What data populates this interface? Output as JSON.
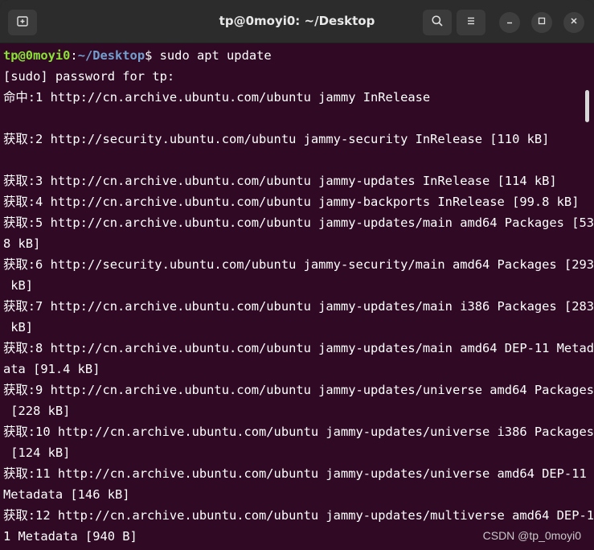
{
  "window": {
    "title": "tp@0moyi0: ~/Desktop"
  },
  "toolbar": {
    "new_tab_icon": "new-tab-icon",
    "search_icon": "search-icon",
    "menu_icon": "hamburger-menu-icon",
    "minimize_icon": "minimize-icon",
    "maximize_icon": "maximize-icon",
    "close_icon": "close-icon"
  },
  "prompt": {
    "user": "tp@0moyi0",
    "sep": ":",
    "path": "~/Desktop",
    "dollar": "$ ",
    "command": "sudo apt update"
  },
  "output": [
    "[sudo] password for tp:",
    "命中:1 http://cn.archive.ubuntu.com/ubuntu jammy InRelease",
    "",
    "获取:2 http://security.ubuntu.com/ubuntu jammy-security InRelease [110 kB]",
    "",
    "获取:3 http://cn.archive.ubuntu.com/ubuntu jammy-updates InRelease [114 kB]",
    "获取:4 http://cn.archive.ubuntu.com/ubuntu jammy-backports InRelease [99.8 kB]",
    "获取:5 http://cn.archive.ubuntu.com/ubuntu jammy-updates/main amd64 Packages [53",
    "8 kB]",
    "获取:6 http://security.ubuntu.com/ubuntu jammy-security/main amd64 Packages [293",
    " kB]",
    "获取:7 http://cn.archive.ubuntu.com/ubuntu jammy-updates/main i386 Packages [283",
    " kB]",
    "获取:8 http://cn.archive.ubuntu.com/ubuntu jammy-updates/main amd64 DEP-11 Metad",
    "ata [91.4 kB]",
    "获取:9 http://cn.archive.ubuntu.com/ubuntu jammy-updates/universe amd64 Packages",
    " [228 kB]",
    "获取:10 http://cn.archive.ubuntu.com/ubuntu jammy-updates/universe i386 Packages",
    " [124 kB]",
    "获取:11 http://cn.archive.ubuntu.com/ubuntu jammy-updates/universe amd64 DEP-11",
    "Metadata [146 kB]",
    "获取:12 http://cn.archive.ubuntu.com/ubuntu jammy-updates/multiverse amd64 DEP-1",
    "1 Metadata [940 B]"
  ],
  "watermark": "CSDN @tp_0moyi0",
  "colors": {
    "background": "#300a24",
    "titlebar": "#2c2c2c",
    "prompt_user": "#8ae234",
    "prompt_path": "#729fcf",
    "text": "#ffffff"
  }
}
